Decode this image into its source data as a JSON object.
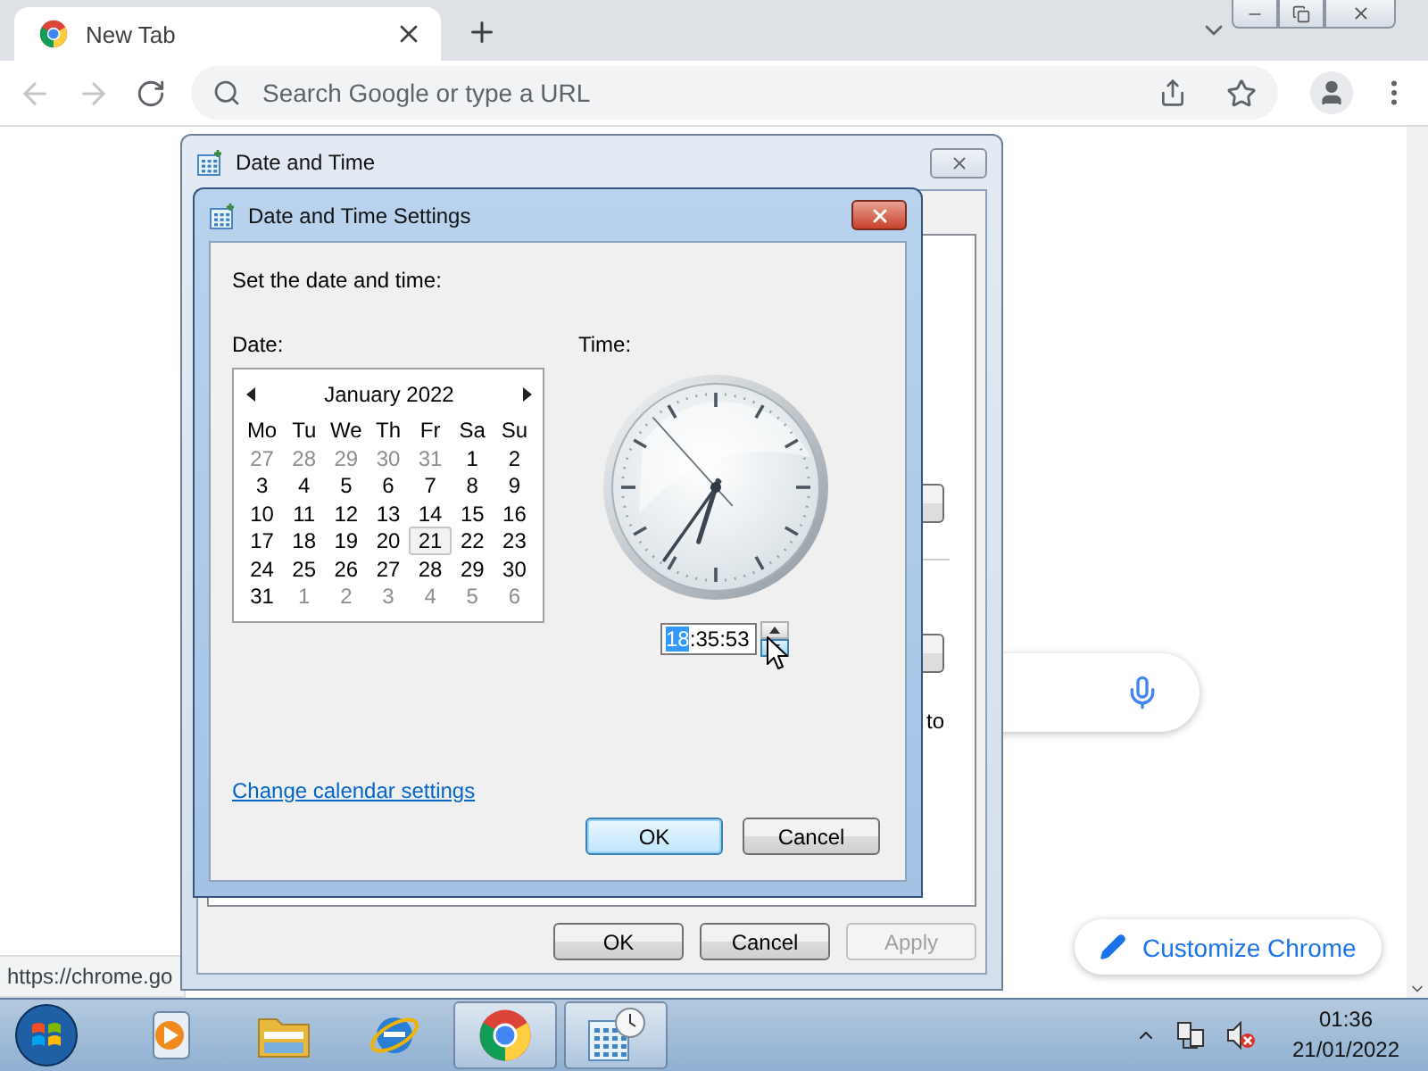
{
  "browser": {
    "tabs": [
      {
        "title": "New Tab",
        "selected": true
      }
    ],
    "back_disabled": true,
    "forward_disabled": true,
    "omnibox": {
      "placeholder": "Search Google or type a URL"
    },
    "customize_button": "Customize Chrome",
    "status_url": "https://chrome.go"
  },
  "outer_dialog": {
    "title": "Date and Time",
    "partial_text": "to",
    "buttons": [
      {
        "label": "OK",
        "disabled": false
      },
      {
        "label": "Cancel",
        "disabled": false
      },
      {
        "label": "Apply",
        "disabled": true
      }
    ]
  },
  "settings_dialog": {
    "title": "Date and Time Settings",
    "instruction": "Set the date and time:",
    "date_label": "Date:",
    "time_label": "Time:",
    "calendar": {
      "month": "January 2022",
      "weekdays": [
        "Mo",
        "Tu",
        "We",
        "Th",
        "Fr",
        "Sa",
        "Su"
      ],
      "days": [
        {
          "day": "27",
          "in_month": false,
          "selected": false
        },
        {
          "day": "28",
          "in_month": false,
          "selected": false
        },
        {
          "day": "29",
          "in_month": false,
          "selected": false
        },
        {
          "day": "30",
          "in_month": false,
          "selected": false
        },
        {
          "day": "31",
          "in_month": false,
          "selected": false
        },
        {
          "day": "1",
          "in_month": true,
          "selected": false
        },
        {
          "day": "2",
          "in_month": true,
          "selected": false
        },
        {
          "day": "3",
          "in_month": true,
          "selected": false
        },
        {
          "day": "4",
          "in_month": true,
          "selected": false
        },
        {
          "day": "5",
          "in_month": true,
          "selected": false
        },
        {
          "day": "6",
          "in_month": true,
          "selected": false
        },
        {
          "day": "7",
          "in_month": true,
          "selected": false
        },
        {
          "day": "8",
          "in_month": true,
          "selected": false
        },
        {
          "day": "9",
          "in_month": true,
          "selected": false
        },
        {
          "day": "10",
          "in_month": true,
          "selected": false
        },
        {
          "day": "11",
          "in_month": true,
          "selected": false
        },
        {
          "day": "12",
          "in_month": true,
          "selected": false
        },
        {
          "day": "13",
          "in_month": true,
          "selected": false
        },
        {
          "day": "14",
          "in_month": true,
          "selected": false
        },
        {
          "day": "15",
          "in_month": true,
          "selected": false
        },
        {
          "day": "16",
          "in_month": true,
          "selected": false
        },
        {
          "day": "17",
          "in_month": true,
          "selected": false
        },
        {
          "day": "18",
          "in_month": true,
          "selected": false
        },
        {
          "day": "19",
          "in_month": true,
          "selected": false
        },
        {
          "day": "20",
          "in_month": true,
          "selected": false
        },
        {
          "day": "21",
          "in_month": true,
          "selected": true
        },
        {
          "day": "22",
          "in_month": true,
          "selected": false
        },
        {
          "day": "23",
          "in_month": true,
          "selected": false
        },
        {
          "day": "24",
          "in_month": true,
          "selected": false
        },
        {
          "day": "25",
          "in_month": true,
          "selected": false
        },
        {
          "day": "26",
          "in_month": true,
          "selected": false
        },
        {
          "day": "27",
          "in_month": true,
          "selected": false
        },
        {
          "day": "28",
          "in_month": true,
          "selected": false
        },
        {
          "day": "29",
          "in_month": true,
          "selected": false
        },
        {
          "day": "30",
          "in_month": true,
          "selected": false
        },
        {
          "day": "31",
          "in_month": true,
          "selected": false
        },
        {
          "day": "1",
          "in_month": false,
          "selected": false
        },
        {
          "day": "2",
          "in_month": false,
          "selected": false
        },
        {
          "day": "3",
          "in_month": false,
          "selected": false
        },
        {
          "day": "4",
          "in_month": false,
          "selected": false
        },
        {
          "day": "5",
          "in_month": false,
          "selected": false
        },
        {
          "day": "6",
          "in_month": false,
          "selected": false
        }
      ]
    },
    "time": {
      "hours": {
        "text": "18",
        "selected": true
      },
      "separator": ":",
      "minutes": {
        "text": "35",
        "selected": false
      },
      "seconds": {
        "text": "53",
        "selected": false
      }
    },
    "spin_buttons": [
      {
        "kind": "up",
        "hovered": false
      },
      {
        "kind": "down",
        "hovered": true
      }
    ],
    "link": "Change calendar settings",
    "buttons": [
      {
        "label": "OK",
        "default": true
      },
      {
        "label": "Cancel",
        "default": false
      }
    ]
  },
  "taskbar": {
    "apps": [
      {
        "kind": "media-player",
        "active": false
      },
      {
        "kind": "folder",
        "active": false
      },
      {
        "kind": "internet-explorer",
        "active": false
      },
      {
        "kind": "chrome",
        "active": true
      },
      {
        "kind": "date-time",
        "active": true
      }
    ],
    "clock": {
      "time": "01:36",
      "date": "21/01/2022"
    }
  }
}
